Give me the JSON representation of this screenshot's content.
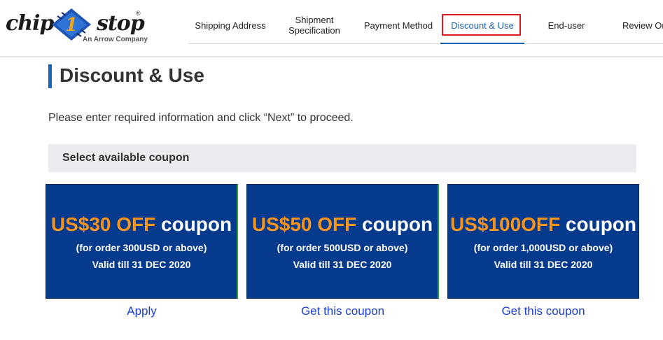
{
  "logo": {
    "word_left": "chip",
    "badge": "1",
    "word_right": "stop",
    "registered": "®",
    "tagline": "An Arrow Company"
  },
  "steps": [
    {
      "label": "Shipping Address",
      "active": false
    },
    {
      "label": "Shipment Specification",
      "active": false
    },
    {
      "label": "Payment Method",
      "active": false
    },
    {
      "label": "Discount & Use",
      "active": true
    },
    {
      "label": "End-user",
      "active": false
    },
    {
      "label": "Review Or",
      "active": false
    }
  ],
  "page": {
    "title": "Discount & Use",
    "instruction": "Please enter required information and click “Next” to proceed."
  },
  "section": {
    "label": "Select available coupon"
  },
  "coupons": [
    {
      "amount": "US$30 OFF",
      "word": "coupon",
      "condition": "(for order 300USD or above)",
      "validity": "Valid till 31 DEC 2020",
      "action": "Apply"
    },
    {
      "amount": "US$50 OFF",
      "word": "coupon",
      "condition": "(for order 500USD or above)",
      "validity": "Valid till 31 DEC 2020",
      "action": "Get this coupon"
    },
    {
      "amount": "US$100OFF",
      "word": "coupon",
      "condition": "(for order 1,000USD or above)",
      "validity": "Valid till 31 DEC 2020",
      "action": "Get this coupon"
    }
  ],
  "colors": {
    "accent": "#1565b8",
    "highlight_box": "#e0191e",
    "coupon_bg": "#063a8c",
    "coupon_amount": "#f7941d",
    "link": "#1a3fd0"
  }
}
